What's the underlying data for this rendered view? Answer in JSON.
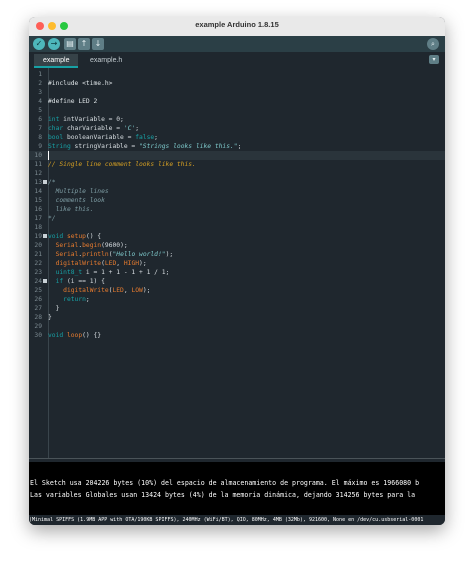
{
  "window": {
    "title": "example Arduino 1.8.15"
  },
  "toolbar": {
    "verify_icon": "✓",
    "upload_icon": "→",
    "new_icon": "▤",
    "open_icon": "↑",
    "save_icon": "↓",
    "serial_icon": "⌕"
  },
  "tabs": [
    {
      "label": "example"
    },
    {
      "label": "example.h"
    }
  ],
  "tab_menu_icon": "▾",
  "code_lines": [
    {
      "n": "1",
      "text": ""
    },
    {
      "n": "2",
      "text": "#include <time.h>"
    },
    {
      "n": "3",
      "text": ""
    },
    {
      "n": "4",
      "text": "#define LED 2"
    },
    {
      "n": "5",
      "text": ""
    },
    {
      "n": "6",
      "text": "int intVariable = 0;"
    },
    {
      "n": "7",
      "text": "char charVariable = 'C';"
    },
    {
      "n": "8",
      "text": "bool booleanVariable = false;"
    },
    {
      "n": "9",
      "text": "String stringVariable = \"Strings looks like this.\";"
    },
    {
      "n": "10",
      "text": ""
    },
    {
      "n": "11",
      "text": "// Single line comment looks like this."
    },
    {
      "n": "12",
      "text": ""
    },
    {
      "n": "13",
      "text": "/*"
    },
    {
      "n": "14",
      "text": "  Multiple lines"
    },
    {
      "n": "15",
      "text": "  comments look"
    },
    {
      "n": "16",
      "text": "  like this."
    },
    {
      "n": "17",
      "text": "*/"
    },
    {
      "n": "18",
      "text": ""
    },
    {
      "n": "19",
      "text": "void setup() {"
    },
    {
      "n": "20",
      "text": "  Serial.begin(9600);"
    },
    {
      "n": "21",
      "text": "  Serial.println(\"Hello world!\");"
    },
    {
      "n": "22",
      "text": "  digitalWrite(LED, HIGH);"
    },
    {
      "n": "23",
      "text": "  uint8_t i = 1 + 1 - 1 + 1 / 1;"
    },
    {
      "n": "24",
      "text": "  if (i == 1) {"
    },
    {
      "n": "25",
      "text": "    digitalWrite(LED, LOW);"
    },
    {
      "n": "26",
      "text": "    return;"
    },
    {
      "n": "27",
      "text": "  }"
    },
    {
      "n": "28",
      "text": "}"
    },
    {
      "n": "29",
      "text": ""
    },
    {
      "n": "30",
      "text": "void loop() {}"
    }
  ],
  "console": {
    "line1": "El Sketch usa 204226 bytes (10%) del espacio de almacenamiento de programa. El máximo es 1966080 b",
    "line2": "Las variables Globales usan 13424 bytes (4%) de la memoria dinámica, dejando 314256 bytes para la"
  },
  "statusbar": {
    "text": "(Minimal SPIFFS (1.9MB APP with OTA/190KB SPIFFS), 240MHz (WiFi/BT), QIO, 80MHz, 4MB (32Mb), 921600, None en /dev/cu.usbserial-0001"
  }
}
